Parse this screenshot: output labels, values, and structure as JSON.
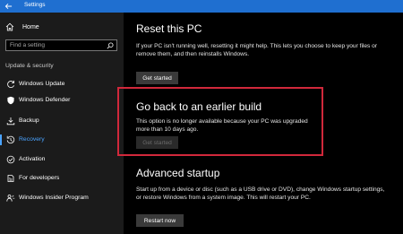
{
  "titlebar": {
    "title": "Settings",
    "color": "#1f6fd0"
  },
  "sidebar": {
    "home_label": "Home",
    "search_placeholder": "Find a setting",
    "section_title": "Update & security",
    "items": [
      {
        "label": "Windows Update",
        "icon": "refresh-icon"
      },
      {
        "label": "Windows Defender",
        "icon": "shield-icon"
      },
      {
        "label": "Backup",
        "icon": "backup-icon"
      },
      {
        "label": "Recovery",
        "icon": "recovery-icon",
        "active": true
      },
      {
        "label": "Activation",
        "icon": "activation-icon"
      },
      {
        "label": "For developers",
        "icon": "developers-icon"
      },
      {
        "label": "Windows Insider Program",
        "icon": "insider-icon"
      }
    ],
    "accent": "#4aa3ff"
  },
  "main": {
    "reset": {
      "title": "Reset this PC",
      "description": "If your PC isn't running well, resetting it might help. This lets you choose to keep your files or remove them, and then reinstalls Windows.",
      "button": "Get started"
    },
    "go_back": {
      "title": "Go back to an earlier build",
      "description": "This option is no longer available because your PC was upgraded more than 10 days ago.",
      "button": "Get started",
      "highlight_color": "#d1283b"
    },
    "advanced": {
      "title": "Advanced startup",
      "description": "Start up from a device or disc (such as a USB drive or DVD), change Windows startup settings, or restore Windows from a system image. This will restart your PC.",
      "button": "Restart now"
    }
  }
}
